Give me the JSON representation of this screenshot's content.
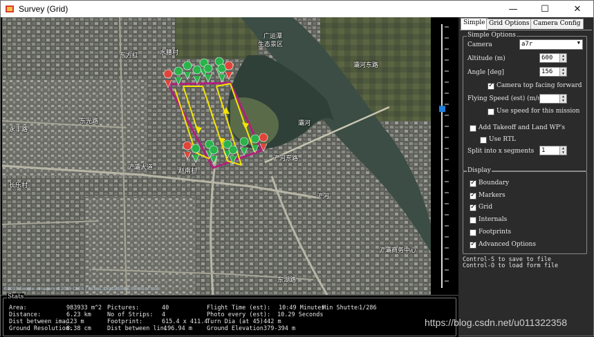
{
  "window": {
    "title": "Survey (Grid)",
    "minimize_glyph": "—",
    "maximize_glyph": "☐",
    "close_glyph": "✕"
  },
  "tabs": [
    {
      "label": "Simple",
      "active": true
    },
    {
      "label": "Grid Options",
      "active": false
    },
    {
      "label": "Camera Config",
      "active": false
    }
  ],
  "simple_options": {
    "group_title": "Simple Options",
    "camera_label": "Camera",
    "camera_value": "a7r",
    "altitude_label": "Altitude (m)",
    "altitude_value": "600",
    "angle_label": "Angle [deg]",
    "angle_value": "156",
    "camera_top_facing_label": "Camera top facing forward",
    "camera_top_facing_checked": true,
    "flying_speed_label": "Flying Speed (est) (m/s)",
    "flying_speed_value": "",
    "use_speed_label": "Use speed for this mission",
    "use_speed_checked": false,
    "add_takeoff_label": "Add Takeoff and Land WP's",
    "add_takeoff_checked": false,
    "use_rtl_label": "Use RTL",
    "use_rtl_checked": false,
    "split_label": "Split into x segments",
    "split_value": "1"
  },
  "display": {
    "group_title": "Display",
    "items": [
      {
        "label": "Boundary",
        "checked": true
      },
      {
        "label": "Markers",
        "checked": true
      },
      {
        "label": "Grid",
        "checked": true
      },
      {
        "label": "Internals",
        "checked": false
      },
      {
        "label": "Footprints",
        "checked": false
      },
      {
        "label": "Advanced Options",
        "checked": true
      }
    ]
  },
  "hints": {
    "save": "Control-S to save to file",
    "load": "Control-O to load form file"
  },
  "map": {
    "labels": [
      "灞河",
      "广运潭",
      "生态景区",
      "东方红",
      "水腰村",
      "永丰路",
      "东光路",
      "长乐村",
      "浐灞大道",
      "赵南村",
      "浐河东路",
      "浐灞商务中心",
      "东湖路",
      "灞河东路",
      "浐河"
    ],
    "attribution": "©2019 Google - Imagery ©2019 CNES / Airbus, DigitalGlobe, Terms of Use"
  },
  "stats": {
    "group_title": "Stats",
    "area_label": "Area:",
    "area_value": "983933 m^2",
    "distance_label": "Distance:",
    "distance_value": "6.23 km",
    "dist_images_label": "Dist between images:",
    "dist_images_value": "123 m",
    "ground_res_label": "Ground Resolution:",
    "ground_res_value": "8.38 cm",
    "pictures_label": "Pictures:",
    "pictures_value": "40",
    "strips_label": "No of Strips:",
    "strips_value": "4",
    "footprint_label": "Footprint:",
    "footprint_value": "615.4 x 411.4",
    "dist_lines_label": "Dist between lines:",
    "dist_lines_value": "196.94 m",
    "flight_time_label": "Flight Time (est):",
    "flight_time_value": "10:49 Minutes",
    "min_shutter_label": "Min Shutter Speed:",
    "min_shutter_value": "1/286",
    "photo_every_label": "Photo every (est):",
    "photo_every_value": "10.29 Seconds",
    "turn_dia_label": "Turn Dia (at 45):",
    "turn_dia_value": "442 m",
    "ground_elev_label": "Ground Elevation:",
    "ground_elev_value": "379-394 m"
  },
  "watermark": "https://blog.csdn.net/u011322358",
  "zoom_level_fraction": 0.32,
  "colors": {
    "boundary": "#b0207a",
    "grid": "#f4e400",
    "marker_green": "#29b34a",
    "marker_red": "#e0453a",
    "panel_bg": "#2b2b2b",
    "zoom_thumb": "#1f7fdc"
  }
}
